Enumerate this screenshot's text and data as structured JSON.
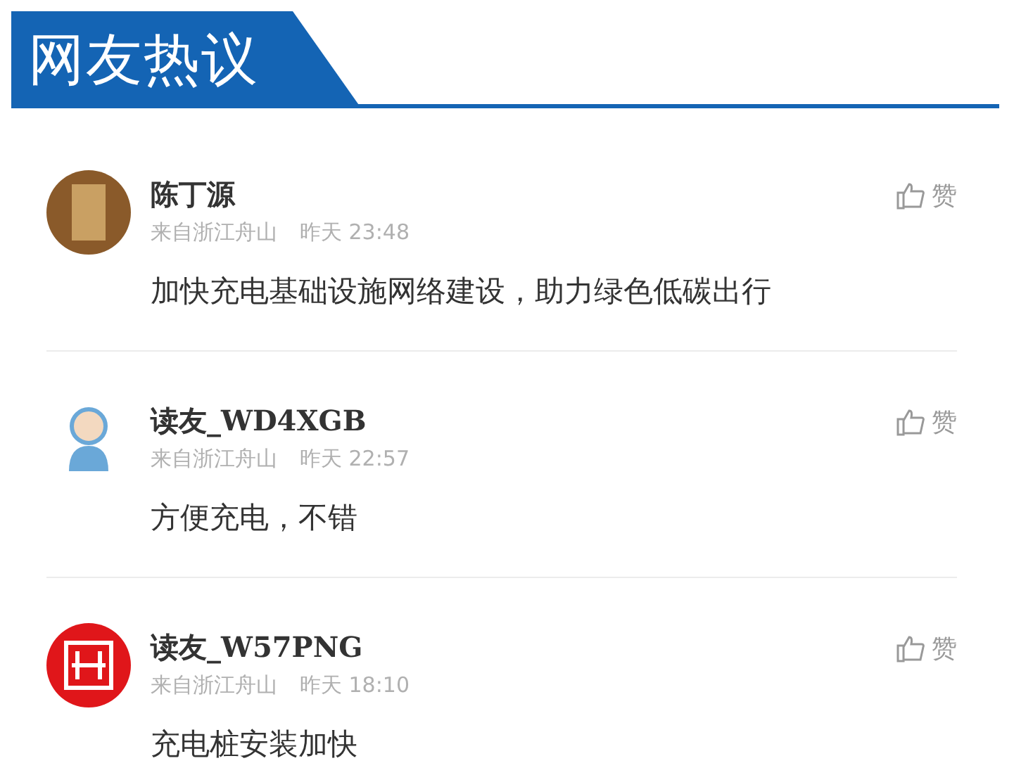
{
  "header": {
    "title": "网友热议"
  },
  "comments": [
    {
      "kind": "photo",
      "name": "陈丁源",
      "location": "来自浙江舟山",
      "time": "昨天 23:48",
      "like_label": "赞",
      "text": "加快充电基础设施网络建设，助力绿色低碳出行"
    },
    {
      "kind": "cartoon",
      "name": "读友_WD4XGB",
      "location": "来自浙江舟山",
      "time": "昨天 22:57",
      "like_label": "赞",
      "text": "方便充电，不错"
    },
    {
      "kind": "stamp",
      "name": "读友_W57PNG",
      "location": "来自浙江舟山",
      "time": "昨天 18:10",
      "like_label": "赞",
      "text": "充电桩安装加快"
    }
  ]
}
